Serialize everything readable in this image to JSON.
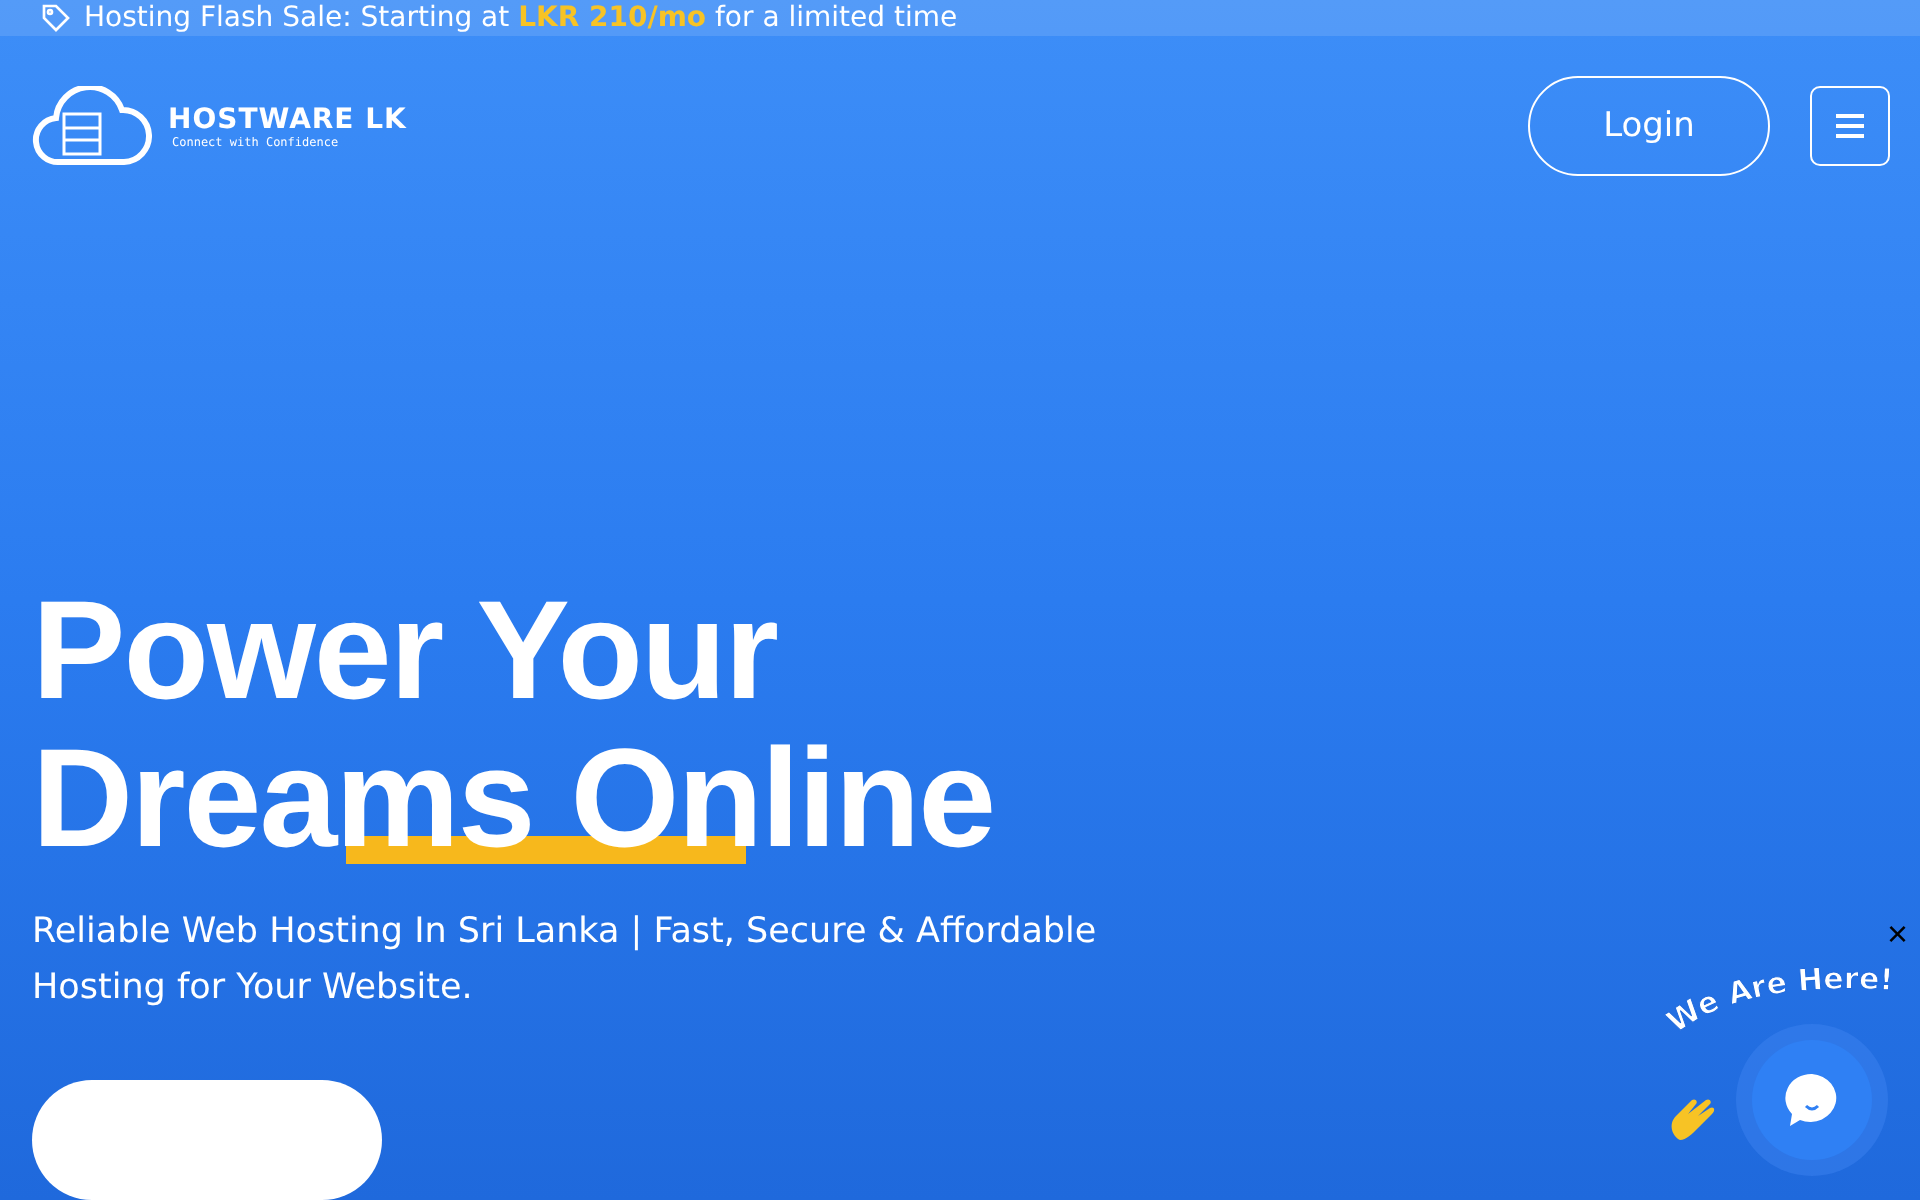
{
  "announcement": {
    "text": "Hosting Flash Sale: Starting at",
    "price": "LKR 210/mo",
    "suffix": "for a limited time"
  },
  "logo": {
    "name": "HOSTWARE LK",
    "tagline": "Connect with Confidence"
  },
  "header": {
    "login": "Login"
  },
  "hero": {
    "title_lines": [
      "Power Your",
      "Dreams Online"
    ],
    "subtitle": "Reliable Web Hosting In Sri Lanka | Fast, Secure & Affordable Hosting for Your Website."
  },
  "chat_widget": {
    "greeting": "We Are Here!",
    "close": "×"
  }
}
